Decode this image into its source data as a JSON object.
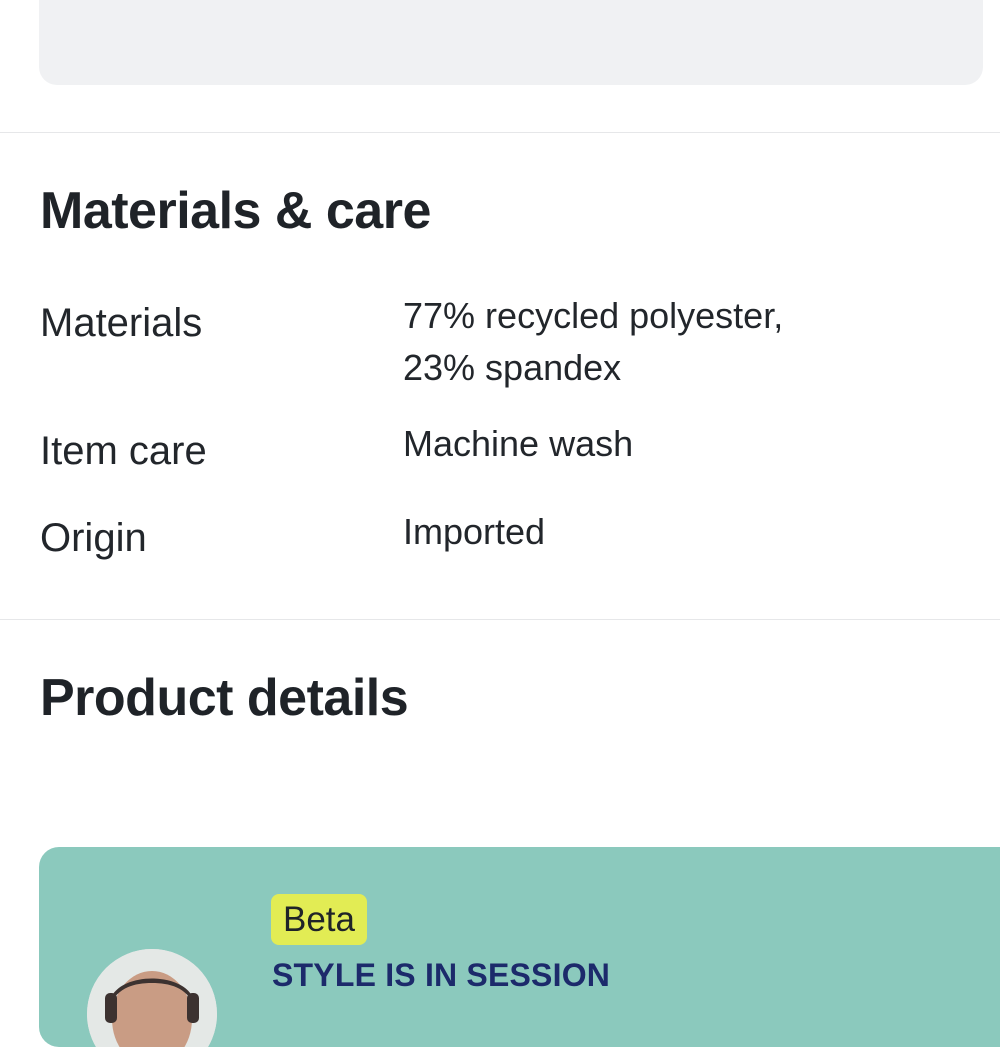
{
  "materials_care": {
    "title": "Materials & care",
    "rows": [
      {
        "label": "Materials",
        "value_line1": "77% recycled polyester,",
        "value_line2": "23% spandex"
      },
      {
        "label": "Item care",
        "value_line1": "Machine wash"
      },
      {
        "label": "Origin",
        "value_line1": "Imported"
      }
    ]
  },
  "product_details": {
    "title": "Product details"
  },
  "promo": {
    "badge": "Beta",
    "heading": "STYLE IS IN SESSION",
    "avatar_icon": "stylist-avatar"
  },
  "colors": {
    "promo_background": "#8bc9bd",
    "badge_background": "#e2ec54",
    "heading_color": "#1c2a6b",
    "top_card_background": "#f0f1f3"
  }
}
